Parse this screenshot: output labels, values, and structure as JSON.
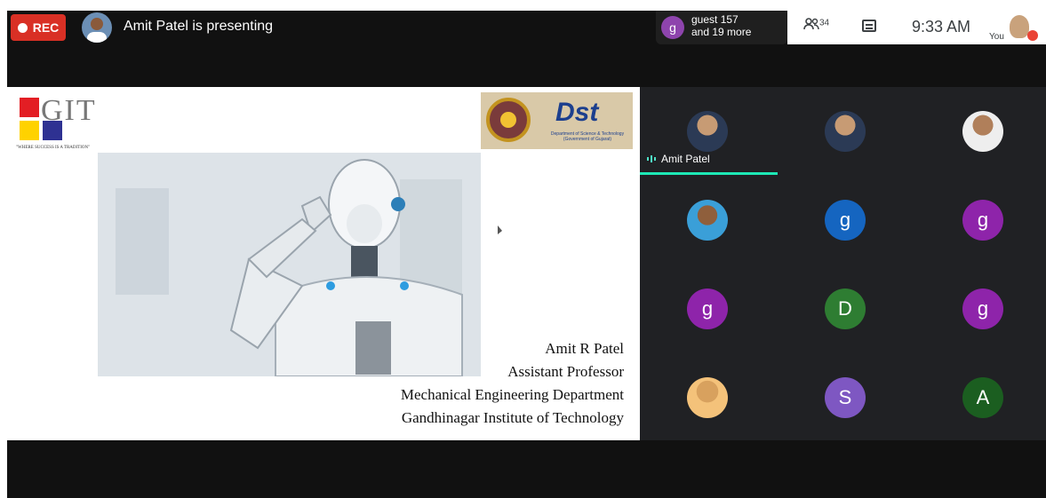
{
  "topbar": {
    "rec_label": "REC",
    "presenting_text": "Amit Patel is presenting",
    "guest_initial": "g",
    "guest_line1": "guest 157",
    "guest_line2": "and 19 more",
    "people_count": "34",
    "time": "9:33 AM",
    "you_label": "You"
  },
  "slide": {
    "logo_text": "GIT",
    "logo_tagline": "\"WHERE SUCCESS IS A TRADITION\"",
    "dst_word": "Dst",
    "dst_sub": "Department of Science & Technology (Government of Gujarat)",
    "credits": [
      "Amit R Patel",
      "Assistant Professor",
      "Mechanical Engineering Department",
      "Gandhinagar Institute of Technology"
    ]
  },
  "participants": [
    {
      "name": "Amit Patel",
      "initial": "",
      "color": ""
    },
    {
      "name": "",
      "initial": "",
      "color": ""
    },
    {
      "name": "",
      "initial": "",
      "color": ""
    },
    {
      "name": "",
      "initial": "",
      "color": ""
    },
    {
      "name": "",
      "initial": "g",
      "color": "#1565c0"
    },
    {
      "name": "",
      "initial": "g",
      "color": "#8e24aa"
    },
    {
      "name": "",
      "initial": "g",
      "color": "#8e24aa"
    },
    {
      "name": "",
      "initial": "D",
      "color": "#2e7d32"
    },
    {
      "name": "",
      "initial": "g",
      "color": "#8e24aa"
    },
    {
      "name": "",
      "initial": "",
      "color": ""
    },
    {
      "name": "",
      "initial": "S",
      "color": "#7e57c2"
    },
    {
      "name": "",
      "initial": "A",
      "color": "#1b5e20"
    }
  ],
  "colors": {
    "rec": "#d93025",
    "speaking_indicator": "#1de9b6"
  }
}
